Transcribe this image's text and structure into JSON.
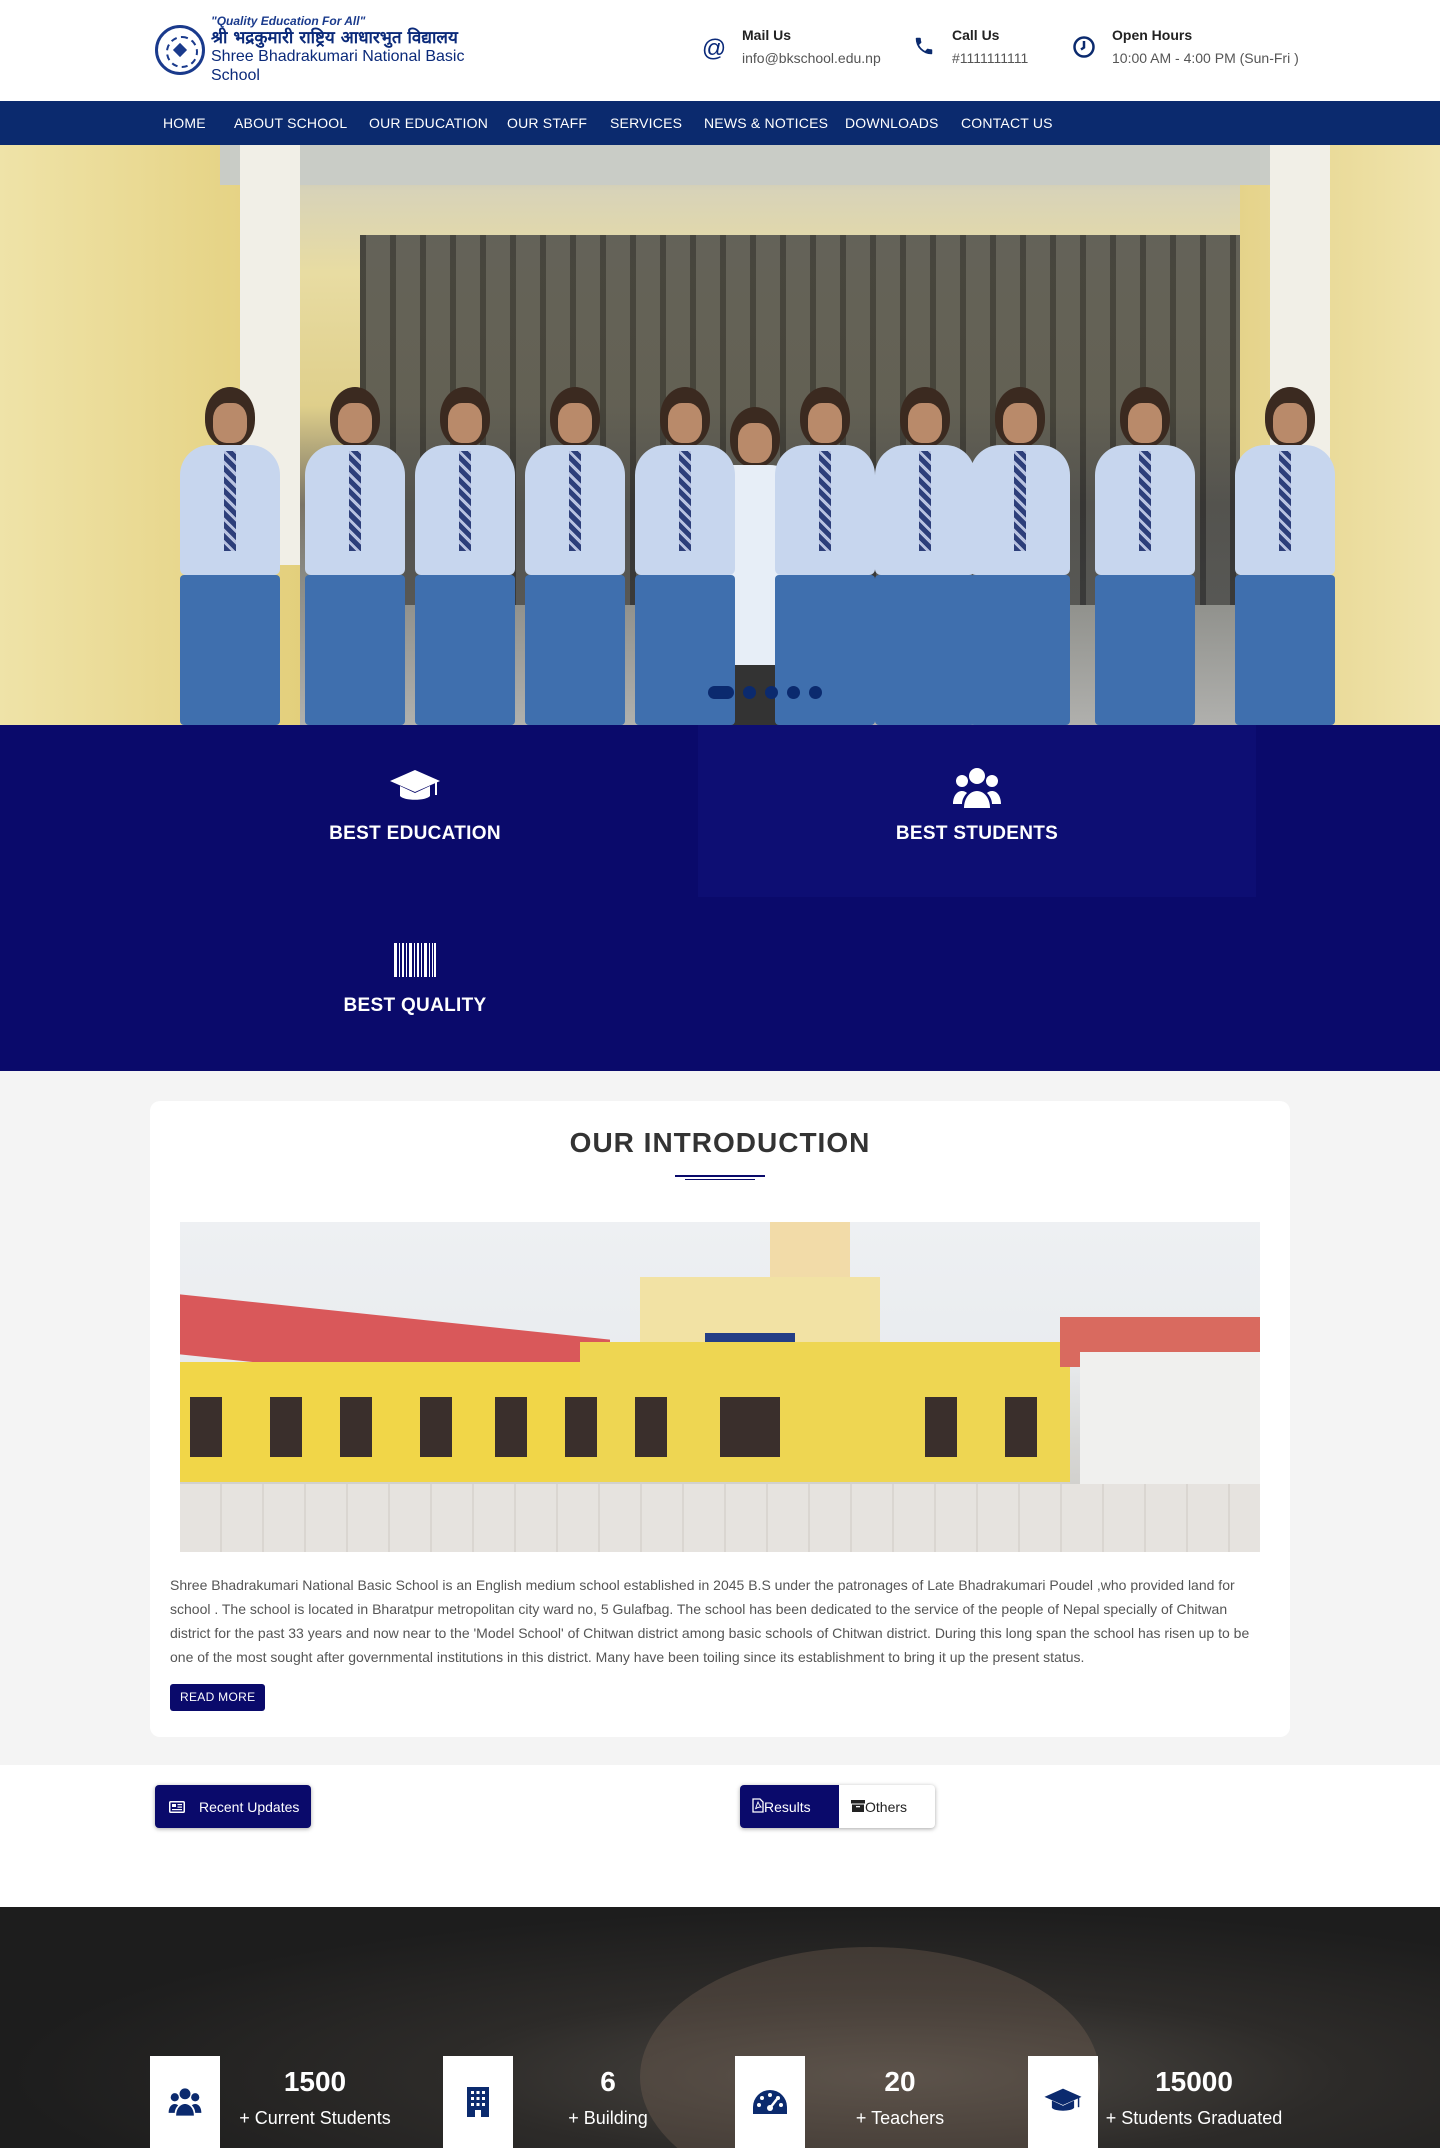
{
  "header": {
    "logo": {
      "tagline": "\"Quality Education For All\"",
      "name_nepali": "श्री भद्रकुमारी राष्ट्रिय आधारभुत विद्यालय",
      "name_english": "Shree Bhadrakumari National Basic School"
    },
    "contacts": [
      {
        "icon": "at-icon",
        "label": "Mail Us",
        "value": "info@bkschool.edu.np"
      },
      {
        "icon": "phone-icon",
        "label": "Call Us",
        "value": "#1111111111"
      },
      {
        "icon": "clock-icon",
        "label": "Open Hours",
        "value": "10:00 AM - 4:00 PM (Sun-Fri )"
      }
    ]
  },
  "nav": {
    "items": [
      "HOME",
      "ABOUT SCHOOL",
      "OUR EDUCATION",
      "OUR STAFF",
      "SERVICES",
      "NEWS & NOTICES",
      "DOWNLOADS",
      "CONTACT US"
    ]
  },
  "hero": {
    "slide_count": 5,
    "active_slide": 1
  },
  "features": [
    {
      "icon": "graduation-cap-icon",
      "title": "BEST EDUCATION"
    },
    {
      "icon": "users-icon",
      "title": "BEST STUDENTS"
    },
    {
      "icon": "barcode-icon",
      "title": "BEST QUALITY"
    }
  ],
  "intro": {
    "title": "OUR INTRODUCTION",
    "text": "Shree Bhadrakumari National Basic School is an English medium school established in 2045 B.S under the patronages of Late Bhadrakumari Poudel ,who provided land for school . The school is located in Bharatpur metropolitan city ward no, 5 Gulafbag. The school has been dedicated to the service of the people of Nepal specially of Chitwan district for the past 33 years and now near to the 'Model School' of Chitwan district among basic schools of Chitwan district. During this long span the school has risen up to be one of the most sought after governmental institutions in this district. Many have been toiling since its establishment to bring it up the present status.",
    "read_more": "READ MORE"
  },
  "updates": {
    "recent_label": "Recent Updates",
    "tabs": [
      {
        "label": "Results",
        "active": true
      },
      {
        "label": "Others",
        "active": false
      }
    ]
  },
  "stats": [
    {
      "icon": "users-icon",
      "number": "1500",
      "label": "+ Current Students"
    },
    {
      "icon": "building-icon",
      "number": "6",
      "label": "+ Building"
    },
    {
      "icon": "dashboard-icon",
      "number": "20",
      "label": "+ Teachers"
    },
    {
      "icon": "graduation-cap-icon",
      "number": "15000",
      "label": "+ Students Graduated"
    }
  ],
  "colors": {
    "navy": "#0b2a6e",
    "feature_bg": "#0a0a6b",
    "text": "#333333"
  }
}
